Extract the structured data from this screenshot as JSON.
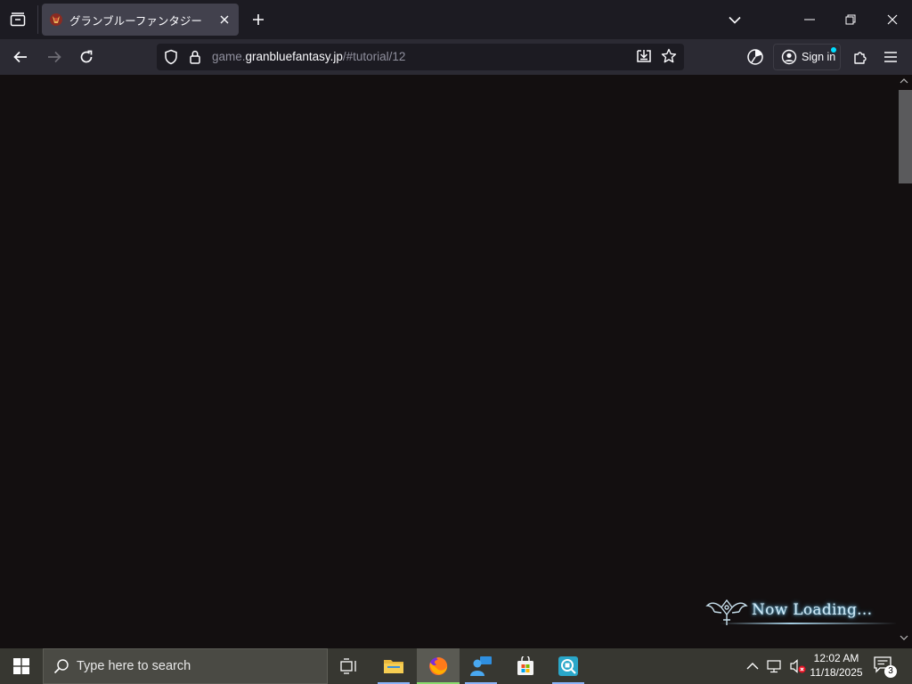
{
  "browser": {
    "tab": {
      "title": "グランブルーファンタジー"
    },
    "url": {
      "prefix": "game.",
      "domain": "granbluefantasy.jp",
      "path": "/#tutorial/12"
    },
    "signin_label": "Sign in",
    "colors": {
      "tabstrip": "#1c1b22",
      "navbar": "#2b2a33",
      "active_tab": "#42414d",
      "accent": "#00ddff"
    },
    "icons": [
      "tab-list-icon",
      "close-icon",
      "plus-icon",
      "chevron-down-icon",
      "minimize-icon",
      "restore-icon",
      "window-close-icon",
      "back-arrow-icon",
      "forward-arrow-icon",
      "reload-icon",
      "shield-icon",
      "lock-icon",
      "save-to-pocket-icon",
      "star-icon",
      "tracking-protection-icon",
      "account-icon",
      "extensions-icon",
      "hamburger-menu-icon"
    ]
  },
  "content": {
    "loading_text": "Now Loading...",
    "background": "#130f10"
  },
  "taskbar": {
    "search_placeholder": "Type here to search",
    "apps": [
      "task-view",
      "file-explorer",
      "firefox",
      "people",
      "microsoft-store",
      "qr-scanner"
    ],
    "clock": {
      "time": "12:02 AM",
      "date": "11/18/2025"
    },
    "notification_count": "3"
  }
}
